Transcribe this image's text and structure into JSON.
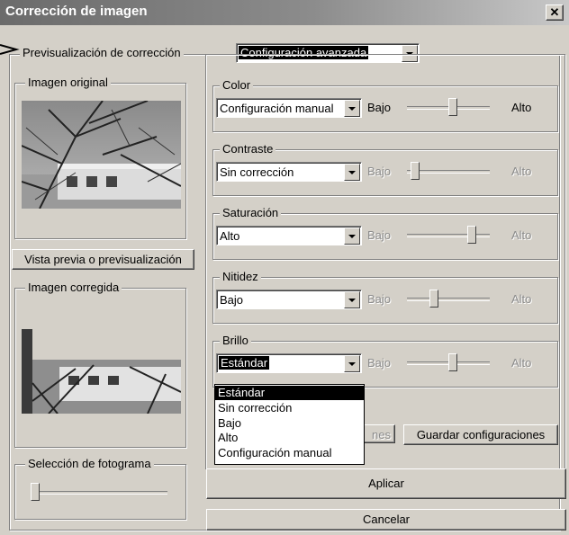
{
  "window": {
    "title": "Corrección de imagen"
  },
  "preview": {
    "label": "Previsualización de corrección",
    "mode_value": "Configuración avanzada",
    "original_label": "Imagen original",
    "preview_button": "Vista previa o previsualización",
    "corrected_label": "Imagen corregida",
    "frame_label": "Selección de fotograma",
    "frame_slider_level": 0.0
  },
  "settings": [
    {
      "name": "Color",
      "value": "Configuración manual",
      "low": "Bajo",
      "high": "Alto",
      "level": 0.55,
      "enabled": true
    },
    {
      "name": "Contraste",
      "value": "Sin corrección",
      "low": "Bajo",
      "high": "Alto",
      "level": 0.05,
      "enabled": false
    },
    {
      "name": "Saturación",
      "value": "Alto",
      "low": "Bajo",
      "high": "Alto",
      "level": 0.8,
      "enabled": false
    },
    {
      "name": "Nitidez",
      "value": "Bajo",
      "low": "Bajo",
      "high": "Alto",
      "level": 0.3,
      "enabled": false
    },
    {
      "name": "Brillo",
      "value": "Estándar",
      "low": "Bajo",
      "high": "Alto",
      "level": 0.55,
      "enabled": false
    }
  ],
  "dropdown": {
    "options": [
      "Estándar",
      "Sin corrección",
      "Bajo",
      "Alto",
      "Configuración manual"
    ],
    "selected_index": 0
  },
  "buttons": {
    "partial_hidden": "nes",
    "save_settings": "Guardar configuraciones",
    "apply": "Aplicar",
    "cancel": "Cancelar"
  }
}
